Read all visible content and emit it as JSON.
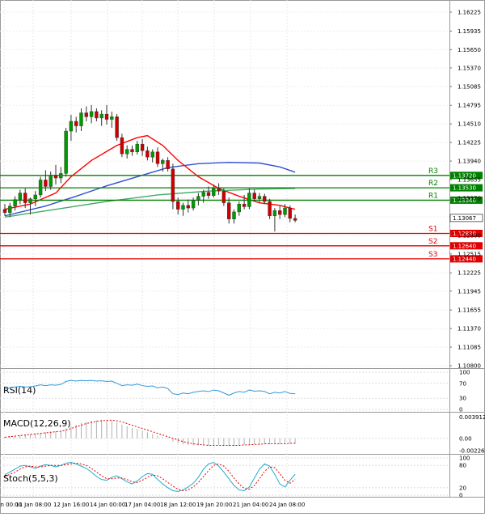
{
  "chart_data": {
    "type": "candlestick",
    "symbol": "EURUSD",
    "timeframe": "H4",
    "price_axis": {
      "ylim": [
        1.108,
        1.163
      ],
      "ticks": [
        "1.16225",
        "1.15935",
        "1.15650",
        "1.15370",
        "1.15085",
        "1.14795",
        "1.14510",
        "1.14225",
        "1.13940",
        "1.13655",
        "1.13370",
        "1.13085",
        "1.12800",
        "1.12515",
        "1.12225",
        "1.11945",
        "1.11655",
        "1.11370",
        "1.11085",
        "1.10800"
      ],
      "last_price": "1.13067"
    },
    "time_axis": {
      "labels": [
        "10 Jan 00:00",
        "11 Jan 08:00",
        "12 Jan 16:00",
        "14 Jan 00:00",
        "17 Jan 04:00",
        "18 Jan 12:00",
        "19 Jan 20:00",
        "21 Jan 04:00",
        "24 Jan 08:00"
      ]
    },
    "candles": [
      {
        "o": 1.132,
        "h": 1.1328,
        "l": 1.131,
        "c": 1.1315
      },
      {
        "o": 1.1315,
        "h": 1.133,
        "l": 1.1308,
        "c": 1.1325
      },
      {
        "o": 1.1325,
        "h": 1.134,
        "l": 1.1318,
        "c": 1.1335
      },
      {
        "o": 1.1335,
        "h": 1.135,
        "l": 1.1328,
        "c": 1.1345
      },
      {
        "o": 1.1345,
        "h": 1.1352,
        "l": 1.1322,
        "c": 1.133
      },
      {
        "o": 1.133,
        "h": 1.1338,
        "l": 1.1312,
        "c": 1.1336
      },
      {
        "o": 1.1336,
        "h": 1.1348,
        "l": 1.1325,
        "c": 1.1342
      },
      {
        "o": 1.1342,
        "h": 1.137,
        "l": 1.1338,
        "c": 1.1365
      },
      {
        "o": 1.1365,
        "h": 1.138,
        "l": 1.1348,
        "c": 1.1355
      },
      {
        "o": 1.1355,
        "h": 1.1378,
        "l": 1.135,
        "c": 1.1372
      },
      {
        "o": 1.1372,
        "h": 1.1388,
        "l": 1.1358,
        "c": 1.1368
      },
      {
        "o": 1.1368,
        "h": 1.1385,
        "l": 1.136,
        "c": 1.1375
      },
      {
        "o": 1.1375,
        "h": 1.1445,
        "l": 1.137,
        "c": 1.144
      },
      {
        "o": 1.144,
        "h": 1.1465,
        "l": 1.1425,
        "c": 1.1455
      },
      {
        "o": 1.1455,
        "h": 1.1462,
        "l": 1.1438,
        "c": 1.1448
      },
      {
        "o": 1.1448,
        "h": 1.1475,
        "l": 1.144,
        "c": 1.1468
      },
      {
        "o": 1.1468,
        "h": 1.1478,
        "l": 1.1455,
        "c": 1.1462
      },
      {
        "o": 1.1462,
        "h": 1.148,
        "l": 1.1452,
        "c": 1.147
      },
      {
        "o": 1.147,
        "h": 1.1475,
        "l": 1.1455,
        "c": 1.146
      },
      {
        "o": 1.146,
        "h": 1.1472,
        "l": 1.1448,
        "c": 1.1466
      },
      {
        "o": 1.1466,
        "h": 1.148,
        "l": 1.145,
        "c": 1.1458
      },
      {
        "o": 1.1458,
        "h": 1.147,
        "l": 1.1445,
        "c": 1.1462
      },
      {
        "o": 1.1462,
        "h": 1.1466,
        "l": 1.1425,
        "c": 1.143
      },
      {
        "o": 1.143,
        "h": 1.1436,
        "l": 1.14,
        "c": 1.1405
      },
      {
        "o": 1.1405,
        "h": 1.1418,
        "l": 1.1398,
        "c": 1.1412
      },
      {
        "o": 1.1412,
        "h": 1.1418,
        "l": 1.1402,
        "c": 1.1408
      },
      {
        "o": 1.1408,
        "h": 1.1425,
        "l": 1.1404,
        "c": 1.142
      },
      {
        "o": 1.142,
        "h": 1.1428,
        "l": 1.1402,
        "c": 1.141
      },
      {
        "o": 1.141,
        "h": 1.1416,
        "l": 1.1395,
        "c": 1.14
      },
      {
        "o": 1.14,
        "h": 1.1412,
        "l": 1.1392,
        "c": 1.1408
      },
      {
        "o": 1.1408,
        "h": 1.1415,
        "l": 1.1385,
        "c": 1.139
      },
      {
        "o": 1.139,
        "h": 1.1398,
        "l": 1.1378,
        "c": 1.1395
      },
      {
        "o": 1.1395,
        "h": 1.14,
        "l": 1.1378,
        "c": 1.1382
      },
      {
        "o": 1.1382,
        "h": 1.139,
        "l": 1.132,
        "c": 1.1332
      },
      {
        "o": 1.1332,
        "h": 1.1338,
        "l": 1.1312,
        "c": 1.132
      },
      {
        "o": 1.132,
        "h": 1.133,
        "l": 1.131,
        "c": 1.1326
      },
      {
        "o": 1.1326,
        "h": 1.1335,
        "l": 1.1315,
        "c": 1.1322
      },
      {
        "o": 1.1322,
        "h": 1.1338,
        "l": 1.1318,
        "c": 1.1334
      },
      {
        "o": 1.1334,
        "h": 1.1345,
        "l": 1.1326,
        "c": 1.134
      },
      {
        "o": 1.134,
        "h": 1.135,
        "l": 1.133,
        "c": 1.1346
      },
      {
        "o": 1.1346,
        "h": 1.1355,
        "l": 1.1336,
        "c": 1.1341
      },
      {
        "o": 1.1341,
        "h": 1.1358,
        "l": 1.1338,
        "c": 1.1352
      },
      {
        "o": 1.1352,
        "h": 1.136,
        "l": 1.1342,
        "c": 1.1348
      },
      {
        "o": 1.1348,
        "h": 1.1352,
        "l": 1.1325,
        "c": 1.133
      },
      {
        "o": 1.133,
        "h": 1.1338,
        "l": 1.1298,
        "c": 1.1305
      },
      {
        "o": 1.1305,
        "h": 1.132,
        "l": 1.1298,
        "c": 1.1316
      },
      {
        "o": 1.1316,
        "h": 1.1332,
        "l": 1.131,
        "c": 1.1328
      },
      {
        "o": 1.1328,
        "h": 1.1342,
        "l": 1.132,
        "c": 1.1324
      },
      {
        "o": 1.1324,
        "h": 1.1352,
        "l": 1.132,
        "c": 1.1345
      },
      {
        "o": 1.1345,
        "h": 1.135,
        "l": 1.1332,
        "c": 1.1336
      },
      {
        "o": 1.1336,
        "h": 1.1345,
        "l": 1.133,
        "c": 1.134
      },
      {
        "o": 1.134,
        "h": 1.1344,
        "l": 1.1328,
        "c": 1.1332
      },
      {
        "o": 1.1332,
        "h": 1.1336,
        "l": 1.1305,
        "c": 1.131
      },
      {
        "o": 1.131,
        "h": 1.1322,
        "l": 1.1286,
        "c": 1.1318
      },
      {
        "o": 1.1318,
        "h": 1.1325,
        "l": 1.1305,
        "c": 1.1312
      },
      {
        "o": 1.1312,
        "h": 1.1328,
        "l": 1.1308,
        "c": 1.1322
      },
      {
        "o": 1.1322,
        "h": 1.1326,
        "l": 1.13,
        "c": 1.1306
      },
      {
        "o": 1.1306,
        "h": 1.1312,
        "l": 1.13,
        "c": 1.1303
      }
    ],
    "moving_averages": [
      {
        "color": "#ff0000",
        "values": [
          [
            0,
            1.132
          ],
          [
            5,
            1.1328
          ],
          [
            10,
            1.1345
          ],
          [
            13,
            1.137
          ],
          [
            17,
            1.1395
          ],
          [
            22,
            1.1418
          ],
          [
            26,
            1.143
          ],
          [
            28,
            1.1433
          ],
          [
            31,
            1.1418
          ],
          [
            34,
            1.1395
          ],
          [
            38,
            1.137
          ],
          [
            42,
            1.1352
          ],
          [
            46,
            1.134
          ],
          [
            50,
            1.133
          ],
          [
            54,
            1.1326
          ],
          [
            57,
            1.132
          ]
        ]
      },
      {
        "color": "#3050d0",
        "values": [
          [
            0,
            1.131
          ],
          [
            8,
            1.1325
          ],
          [
            14,
            1.134
          ],
          [
            20,
            1.1356
          ],
          [
            26,
            1.137
          ],
          [
            32,
            1.1384
          ],
          [
            38,
            1.139
          ],
          [
            44,
            1.1392
          ],
          [
            50,
            1.1391
          ],
          [
            54,
            1.1385
          ],
          [
            57,
            1.1377
          ]
        ]
      },
      {
        "color": "#44aa66",
        "values": [
          [
            0,
            1.1308
          ],
          [
            10,
            1.132
          ],
          [
            20,
            1.1332
          ],
          [
            30,
            1.1342
          ],
          [
            40,
            1.1348
          ],
          [
            50,
            1.1351
          ],
          [
            57,
            1.1352
          ]
        ]
      }
    ],
    "levels": [
      {
        "name": "R3",
        "value": 1.1372,
        "label": "1.13720",
        "color": "#008000"
      },
      {
        "name": "R2",
        "value": 1.1353,
        "label": "1.13530",
        "color": "#008000"
      },
      {
        "name": "R1",
        "value": 1.1334,
        "label": "1.13340",
        "color": "#008000"
      },
      {
        "name": "S1",
        "value": 1.1283,
        "label": "1.12830",
        "color": "#e00000"
      },
      {
        "name": "S2",
        "value": 1.1264,
        "label": "1.12640",
        "color": "#e00000"
      },
      {
        "name": "S3",
        "value": 1.1244,
        "label": "1.12440",
        "color": "#e00000"
      }
    ],
    "rsi": {
      "label": "RSI(14)",
      "ylim": [
        0,
        100
      ],
      "ticks": [
        "100",
        "70",
        "30",
        "0"
      ],
      "values": [
        55,
        58,
        60,
        62,
        60,
        61,
        63,
        66,
        64,
        66,
        65,
        67,
        75,
        78,
        76,
        78,
        77,
        78,
        76,
        77,
        75,
        76,
        70,
        64,
        66,
        65,
        68,
        64,
        62,
        63,
        58,
        60,
        56,
        42,
        40,
        44,
        42,
        46,
        48,
        50,
        48,
        52,
        50,
        44,
        38,
        44,
        48,
        46,
        52,
        49,
        50,
        48,
        42,
        46,
        44,
        48,
        43,
        42
      ]
    },
    "macd": {
      "label": "MACD(12,26,9)",
      "ylim": [
        -0.0024,
        0.0041
      ],
      "ticks": [
        "0.003912",
        "0.00",
        "-0.002267"
      ],
      "hist": [
        0.0003,
        0.0004,
        0.0005,
        0.0006,
        0.0007,
        0.0008,
        0.0009,
        0.001,
        0.0011,
        0.0012,
        0.0013,
        0.0014,
        0.0018,
        0.0022,
        0.0025,
        0.0028,
        0.003,
        0.0032,
        0.0033,
        0.0034,
        0.0033,
        0.0032,
        0.0029,
        0.0025,
        0.0022,
        0.0019,
        0.0017,
        0.0014,
        0.0011,
        0.0008,
        0.0005,
        0.0002,
        -0.0001,
        -0.0006,
        -0.0009,
        -0.0011,
        -0.0012,
        -0.0013,
        -0.0013,
        -0.0013,
        -0.0013,
        -0.0012,
        -0.0012,
        -0.0013,
        -0.0014,
        -0.0014,
        -0.0013,
        -0.0012,
        -0.0011,
        -0.0011,
        -0.001,
        -0.001,
        -0.0011,
        -0.001,
        -0.001,
        -0.0009,
        -0.001,
        -0.001
      ],
      "signal": [
        0.0002,
        0.0003,
        0.0004,
        0.0005,
        0.0006,
        0.0007,
        0.0008,
        0.0009,
        0.001,
        0.0011,
        0.0012,
        0.0013,
        0.0015,
        0.0018,
        0.0021,
        0.0024,
        0.0027,
        0.0029,
        0.0031,
        0.0032,
        0.0033,
        0.0033,
        0.0032,
        0.003,
        0.0027,
        0.0024,
        0.0021,
        0.0018,
        0.0015,
        0.0012,
        0.0009,
        0.0006,
        0.0003,
        0.0,
        -0.0003,
        -0.0006,
        -0.0008,
        -0.001,
        -0.0011,
        -0.0012,
        -0.0013,
        -0.0013,
        -0.0013,
        -0.0013,
        -0.0013,
        -0.0013,
        -0.0013,
        -0.0012,
        -0.0012,
        -0.0011,
        -0.0011,
        -0.001,
        -0.001,
        -0.001,
        -0.001,
        -0.001,
        -0.0009,
        -0.0009
      ]
    },
    "stoch": {
      "label": "Stoch(5,5,3)",
      "ylim": [
        0,
        100
      ],
      "ticks": [
        "100",
        "80",
        "20",
        "0"
      ],
      "main": [
        55,
        62,
        70,
        78,
        80,
        76,
        72,
        78,
        82,
        80,
        76,
        80,
        86,
        88,
        84,
        78,
        72,
        62,
        50,
        42,
        40,
        48,
        52,
        44,
        36,
        30,
        38,
        50,
        58,
        56,
        42,
        30,
        20,
        12,
        10,
        14,
        22,
        32,
        48,
        70,
        84,
        88,
        78,
        62,
        44,
        26,
        14,
        12,
        22,
        46,
        70,
        84,
        78,
        56,
        30,
        22,
        40,
        56
      ],
      "signal": [
        50,
        56,
        62,
        70,
        76,
        78,
        76,
        76,
        78,
        80,
        80,
        80,
        82,
        84,
        86,
        84,
        80,
        72,
        62,
        52,
        44,
        44,
        46,
        46,
        42,
        36,
        34,
        40,
        48,
        54,
        52,
        44,
        34,
        24,
        16,
        12,
        14,
        22,
        34,
        50,
        66,
        80,
        84,
        78,
        64,
        46,
        30,
        18,
        16,
        26,
        44,
        64,
        76,
        74,
        58,
        40,
        32,
        42
      ]
    }
  }
}
